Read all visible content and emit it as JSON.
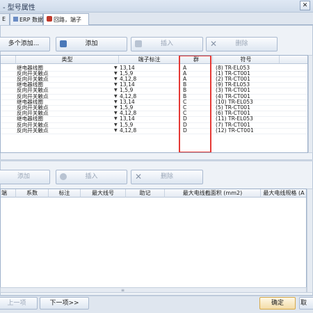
{
  "window": {
    "title": "- 型号属性",
    "close": "✕"
  },
  "tabs": [
    "E",
    "ERP 数据",
    "回路，端子"
  ],
  "toolbar_top": {
    "add_many": "多个添加...",
    "add": "添加",
    "insert": "插入",
    "delete": "删除"
  },
  "grid_top": {
    "columns": [
      "类型",
      "端子标注",
      "群",
      "符号"
    ],
    "rows": [
      {
        "type": "继电器线圈",
        "terminal": "13,14",
        "group": "A",
        "symbol": "(8) TR-EL053"
      },
      {
        "type": "反向开关触点",
        "terminal": "1,5,9",
        "group": "A",
        "symbol": "(1) TR-CT001"
      },
      {
        "type": "反向开关触点",
        "terminal": "4,12,8",
        "group": "A",
        "symbol": "(2) TR-CT001"
      },
      {
        "type": "继电器线圈",
        "terminal": "13,14",
        "group": "B",
        "symbol": "(9) TR-EL053"
      },
      {
        "type": "反向开关触点",
        "terminal": "1,5,9",
        "group": "B",
        "symbol": "(3) TR-CT001"
      },
      {
        "type": "反向开关触点",
        "terminal": "4,12,8",
        "group": "B",
        "symbol": "(4) TR-CT001"
      },
      {
        "type": "继电器线圈",
        "terminal": "13,14",
        "group": "C",
        "symbol": "(10) TR-EL053"
      },
      {
        "type": "反向开关触点",
        "terminal": "1,5,9",
        "group": "C",
        "symbol": "(5) TR-CT001"
      },
      {
        "type": "反向开关触点",
        "terminal": "4,12,8",
        "group": "C",
        "symbol": "(6) TR-CT001"
      },
      {
        "type": "继电器线圈",
        "terminal": "13,14",
        "group": "D",
        "symbol": "(11) TR-EL053"
      },
      {
        "type": "反向开关触点",
        "terminal": "1,5,9",
        "group": "D",
        "symbol": "(7) TR-CT001"
      },
      {
        "type": "反向开关触点",
        "terminal": "4,12,8",
        "group": "D",
        "symbol": "(12) TR-CT001"
      }
    ]
  },
  "toolbar_bottom": {
    "add": "添加",
    "insert": "插入",
    "delete": "删除"
  },
  "grid_bottom": {
    "columns": [
      "端",
      "系数",
      "标注",
      "最大线号",
      "助记",
      "最大电线截面积 (mm2)",
      "最大电线规格 (A"
    ]
  },
  "footer": {
    "prev": "上一项",
    "next": "下一项>>",
    "ok": "确定",
    "cancel": "取"
  },
  "accent": "#e53935"
}
